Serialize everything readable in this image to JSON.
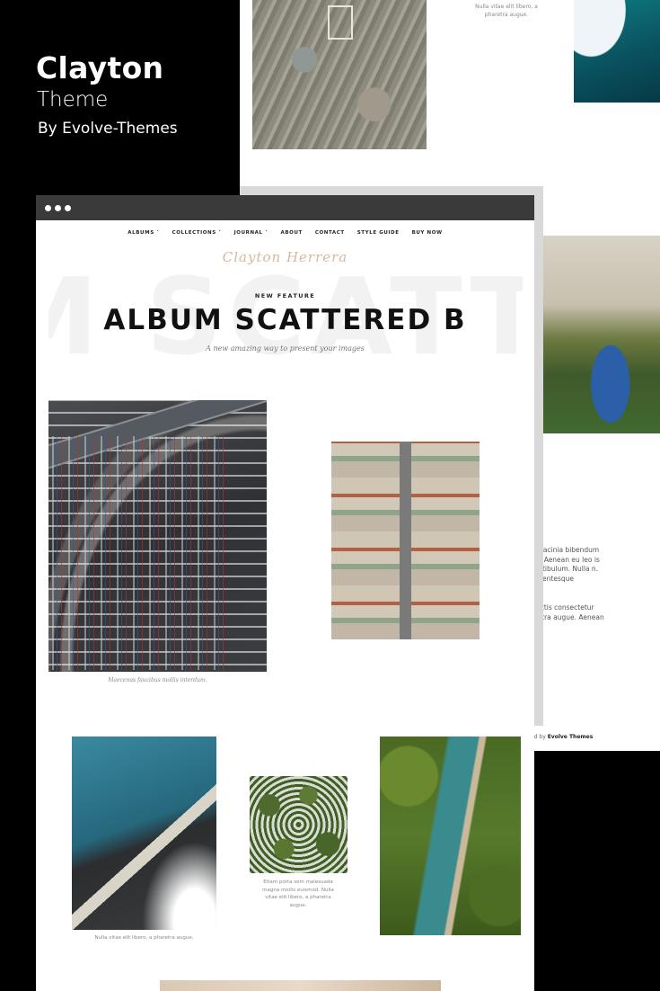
{
  "brand": {
    "title": "Clayton",
    "subtitle": "Theme",
    "by": "By Evolve-Themes"
  },
  "background_page": {
    "caption_top": "Nulla vitae elit libero, a pharetra augue.",
    "text_1": "an lacinia bibendum tor. Aenean eu leo is vestibulum. Nulla n. Pellentesque",
    "text_2": "mattis consectetur aretra augue. Aenean",
    "credit_prefix": "ed by",
    "credit_name": "Evolve Themes"
  },
  "window": {
    "nav": [
      "ALBUMS ˅",
      "COLLECTIONS ˅",
      "JOURNAL ˅",
      "ABOUT",
      "CONTACT",
      "STYLE GUIDE",
      "BUY NOW"
    ],
    "signature": "Clayton Herrera",
    "ghost_text": "M SCATTE",
    "kicker": "NEW FEATURE",
    "headline": "ALBUM SCATTERED B",
    "tagline": "A new amazing way to present your images",
    "captions": {
      "highway": "Maecenas faucibus mollis interdum.",
      "pool": "Nulla vitae elit libero, a pharetra augue.",
      "trees": "Etiam porta sem malesuada magna mollis euismod. Nulla vitae elit libero, a pharetra augue."
    }
  },
  "colors": {
    "background": "#000000",
    "titlebar": "#3a3a3a",
    "signature": "#d8b79d"
  },
  "icons": [
    "window-dot-icon"
  ]
}
